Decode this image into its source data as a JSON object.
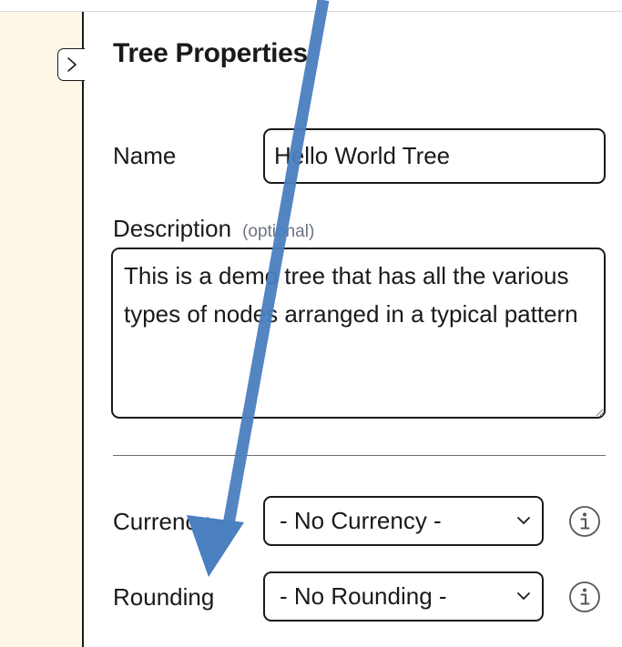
{
  "panel": {
    "title": "Tree Properties",
    "collapse_icon": "chevron-right-icon"
  },
  "form": {
    "name": {
      "label": "Name",
      "value": "Hello World Tree"
    },
    "description": {
      "label": "Description",
      "optional_text": "(optional)",
      "value": "This is a demo tree that has all the various types of nodes arranged in a typical pattern"
    },
    "currency": {
      "label": "Currency",
      "selected": "- No Currency -",
      "info_icon": "info-icon"
    },
    "rounding": {
      "label": "Rounding",
      "selected": "- No Rounding -",
      "info_icon": "info-icon"
    }
  },
  "colors": {
    "sidebar_bg": "#fef6e6",
    "annotation_arrow": "#4a7fc0",
    "border": "#1a1a1a"
  }
}
